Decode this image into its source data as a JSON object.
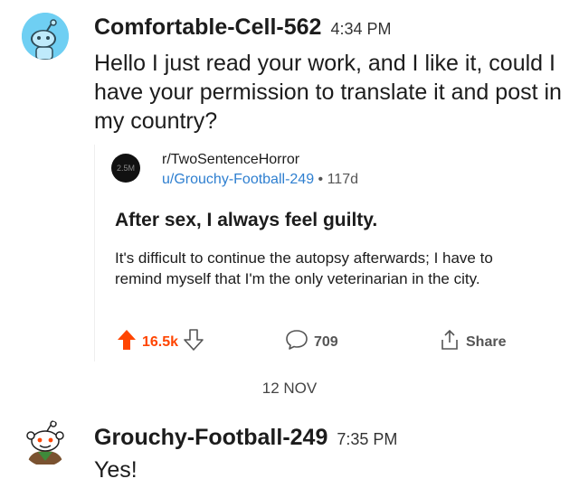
{
  "messages": [
    {
      "username": "Comfortable-Cell-562",
      "time": "4:34 PM",
      "text": "Hello I just read your work, and I like it, could I have your permission to translate it and post in my country?"
    },
    {
      "username": "Grouchy-Football-249",
      "time": "7:35 PM",
      "text": "Yes!"
    }
  ],
  "shared_post": {
    "icon_label": "2.5M",
    "subreddit": "r/TwoSentenceHorror",
    "author": "u/Grouchy-Football-249",
    "age": "117d",
    "title": "After sex, I always feel guilty.",
    "body": "It's difficult to continue the autopsy afterwards; I have to remind myself that I'm the only veterinarian in the city.",
    "votes": "16.5k",
    "comments": "709",
    "share_label": "Share"
  },
  "date_separator": "12 NOV",
  "colors": {
    "upvote": "#ff4500",
    "link": "#2e7fd0",
    "avatar1_bg": "#6fcff3"
  },
  "icons": {
    "upvote": "upvote-arrow-icon",
    "downvote": "downvote-arrow-icon",
    "comment": "comment-bubble-icon",
    "share": "share-icon"
  }
}
